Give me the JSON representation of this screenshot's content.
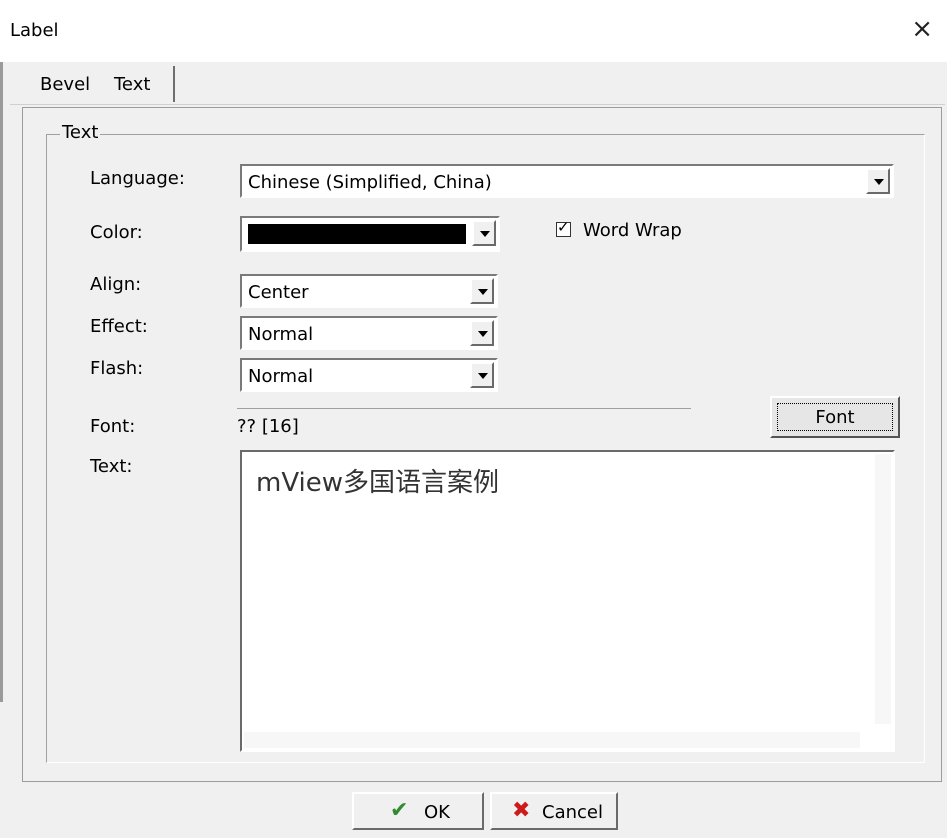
{
  "window": {
    "title": "Label",
    "close_glyph": "×"
  },
  "tabs": [
    {
      "label": "Bevel"
    },
    {
      "label": "Text"
    }
  ],
  "group": {
    "title": "Text",
    "language": {
      "label": "Language:",
      "value": "Chinese (Simplified, China)"
    },
    "color": {
      "label": "Color:",
      "swatch_color": "#000000"
    },
    "word_wrap": {
      "label": "Word Wrap",
      "checked": true
    },
    "align": {
      "label": "Align:",
      "value": "Center"
    },
    "effect": {
      "label": "Effect:",
      "value": "Normal"
    },
    "flash": {
      "label": "Flash:",
      "value": "Normal"
    },
    "font": {
      "label": "Font:",
      "value": "?? [16]",
      "button_label": "Font"
    },
    "text": {
      "label": "Text:",
      "value": "mView多国语言案例"
    }
  },
  "buttons": {
    "ok": {
      "label": "OK",
      "icon": "checkmark-icon",
      "color": "#2e8b2e"
    },
    "cancel": {
      "label": "Cancel",
      "icon": "x-icon",
      "color": "#cc1b1b"
    }
  }
}
